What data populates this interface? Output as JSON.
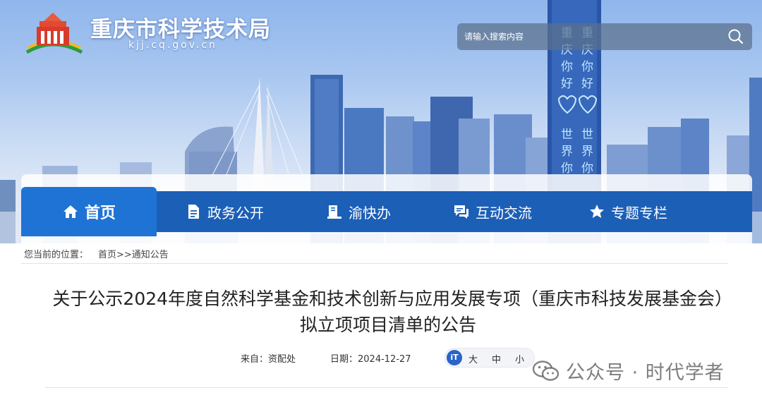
{
  "header": {
    "site_title": "重庆市科学技术局",
    "site_domain": "kjj.cq.gov.cn",
    "search": {
      "placeholder": "请输入搜索内容"
    },
    "tower_text": "重庆你好 世界你好"
  },
  "nav": {
    "items": [
      {
        "label": "首页",
        "icon": "home-icon",
        "active": true
      },
      {
        "label": "政务公开",
        "icon": "document-icon",
        "active": false
      },
      {
        "label": "渝快办",
        "icon": "service-icon",
        "active": false
      },
      {
        "label": "互动交流",
        "icon": "chat-icon",
        "active": false
      },
      {
        "label": "专题专栏",
        "icon": "star-icon",
        "active": false
      }
    ]
  },
  "breadcrumb": {
    "prefix": "您当前的位置：",
    "path": "首页>>通知公告"
  },
  "article": {
    "title": "关于公示2024年度自然科学基金和技术创新与应用发展专项（重庆市科技发展基金会）拟立项项目清单的公告",
    "source_label": "来自：资配处",
    "date_label": "日期：2024-12-27",
    "font_size": {
      "icon_text": "iT",
      "large": "大",
      "medium": "中",
      "small": "小"
    }
  },
  "watermark": {
    "text": "公众号 · 时代学者"
  },
  "colors": {
    "nav_bar": "#1c5fb6",
    "nav_active": "#1f73d4",
    "font_ctrl_icon": "#2a64c8"
  }
}
